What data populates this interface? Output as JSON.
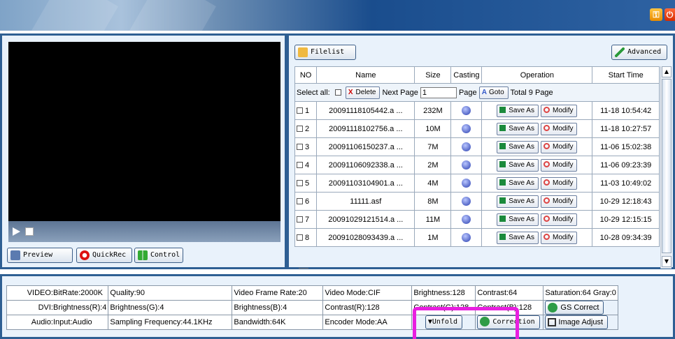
{
  "window": {
    "key_icon": "key-icon",
    "power_icon": "power-icon"
  },
  "preview_panel": {
    "buttons": {
      "preview": "Preview",
      "quickrec": "QuickRec",
      "control": "Control"
    }
  },
  "file_panel": {
    "filelist_label": "Filelist",
    "advanced_label": "Advanced",
    "columns": [
      "NO",
      "Name",
      "Size",
      "Casting",
      "Operation",
      "Start Time"
    ],
    "select_all_label": "Select all:",
    "delete_label": "Delete",
    "next_page_label": "Next Page",
    "page_input_value": "1",
    "page_label": "Page",
    "goto_label": "Goto",
    "total_label": "Total 9  Page",
    "save_as_label": "Save As",
    "modify_label": "Modify",
    "rows": [
      {
        "no": "1",
        "name": "20091118105442.a ...",
        "size": "232M",
        "start": "11-18 10:54:42"
      },
      {
        "no": "2",
        "name": "20091118102756.a ...",
        "size": "10M",
        "start": "11-18 10:27:57"
      },
      {
        "no": "3",
        "name": "20091106150237.a ...",
        "size": "7M",
        "start": "11-06 15:02:38"
      },
      {
        "no": "4",
        "name": "20091106092338.a ...",
        "size": "2M",
        "start": "11-06 09:23:39"
      },
      {
        "no": "5",
        "name": "20091103104901.a ...",
        "size": "4M",
        "start": "11-03 10:49:02"
      },
      {
        "no": "6",
        "name": "11111.asf",
        "size": "8M",
        "start": "10-29 12:18:43"
      },
      {
        "no": "7",
        "name": "20091029121514.a ...",
        "size": "11M",
        "start": "10-29 12:15:15"
      },
      {
        "no": "8",
        "name": "20091028093439.a ...",
        "size": "1M",
        "start": "10-28 09:34:39"
      }
    ]
  },
  "info_panel": {
    "video_label": "VIDEO:",
    "dvi_label": "DVI:",
    "audio_label": "Audio:",
    "video": [
      "BitRate:2000K",
      "Quality:90",
      "Video Frame Rate:20",
      "Video Mode:CIF",
      "Brightness:128",
      "Contrast:64",
      "Saturation:64  Gray:0"
    ],
    "dvi": [
      "Brightness(R):4",
      "Brightness(G):4",
      "Brightness(B):4",
      "Contrast(R):128",
      "Contrast(G):128",
      "Contrast(B):128"
    ],
    "gs_correct": "GS Correct",
    "audio": [
      "Input:Audio",
      "Sampling Frequency:44.1KHz",
      "Bandwidth:64K",
      "Encoder Mode:AA"
    ],
    "unfold": "Unfold",
    "correction": "Correction",
    "image_adjust": "Image Adjust"
  },
  "colors": {
    "frame": "#2e5f93",
    "panel_bg": "#e9f2fb",
    "highlight": "#e81fe0"
  }
}
